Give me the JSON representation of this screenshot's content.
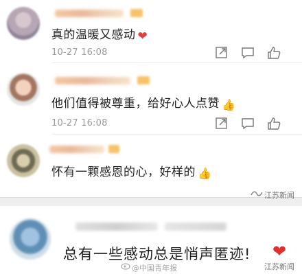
{
  "comments": [
    {
      "text": "真的温暖又感动",
      "emoji": "heart",
      "time": "10-27 16:08"
    },
    {
      "text": "他们值得被尊重，给好心人点赞",
      "emoji": "thumbs-up",
      "time": "10-27 16:08"
    },
    {
      "text": "怀有一颗感恩的心，好样的",
      "emoji": "thumbs-up",
      "time": ""
    }
  ],
  "featured": {
    "text": "总有一些感动总是悄声匿迹!",
    "emoji": "heart"
  },
  "watermarks": {
    "source_left": "@中国青年报",
    "source_right": "江苏新闻"
  },
  "colors": {
    "timestamp": "#9a9a9a",
    "heart": "#e33d3d",
    "thumbs": "#e0a33a"
  }
}
